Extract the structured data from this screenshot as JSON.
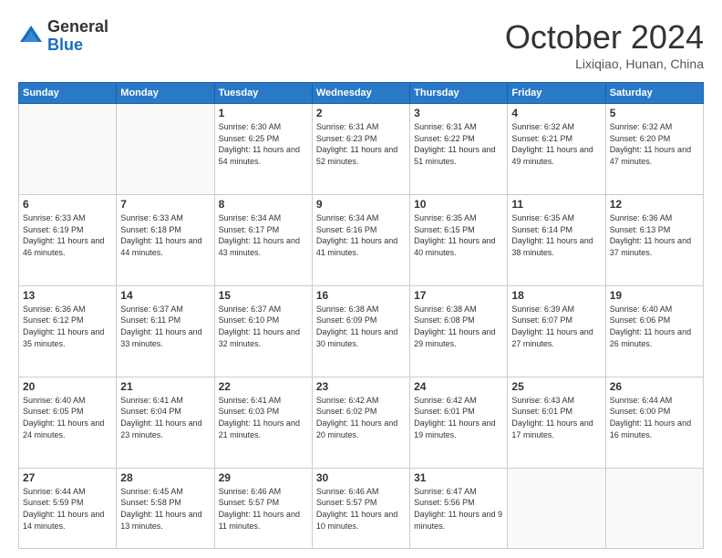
{
  "logo": {
    "general": "General",
    "blue": "Blue"
  },
  "header": {
    "month": "October 2024",
    "location": "Lixiqiao, Hunan, China"
  },
  "weekdays": [
    "Sunday",
    "Monday",
    "Tuesday",
    "Wednesday",
    "Thursday",
    "Friday",
    "Saturday"
  ],
  "weeks": [
    [
      {
        "day": "",
        "info": ""
      },
      {
        "day": "",
        "info": ""
      },
      {
        "day": "1",
        "info": "Sunrise: 6:30 AM\nSunset: 6:25 PM\nDaylight: 11 hours and 54 minutes."
      },
      {
        "day": "2",
        "info": "Sunrise: 6:31 AM\nSunset: 6:23 PM\nDaylight: 11 hours and 52 minutes."
      },
      {
        "day": "3",
        "info": "Sunrise: 6:31 AM\nSunset: 6:22 PM\nDaylight: 11 hours and 51 minutes."
      },
      {
        "day": "4",
        "info": "Sunrise: 6:32 AM\nSunset: 6:21 PM\nDaylight: 11 hours and 49 minutes."
      },
      {
        "day": "5",
        "info": "Sunrise: 6:32 AM\nSunset: 6:20 PM\nDaylight: 11 hours and 47 minutes."
      }
    ],
    [
      {
        "day": "6",
        "info": "Sunrise: 6:33 AM\nSunset: 6:19 PM\nDaylight: 11 hours and 46 minutes."
      },
      {
        "day": "7",
        "info": "Sunrise: 6:33 AM\nSunset: 6:18 PM\nDaylight: 11 hours and 44 minutes."
      },
      {
        "day": "8",
        "info": "Sunrise: 6:34 AM\nSunset: 6:17 PM\nDaylight: 11 hours and 43 minutes."
      },
      {
        "day": "9",
        "info": "Sunrise: 6:34 AM\nSunset: 6:16 PM\nDaylight: 11 hours and 41 minutes."
      },
      {
        "day": "10",
        "info": "Sunrise: 6:35 AM\nSunset: 6:15 PM\nDaylight: 11 hours and 40 minutes."
      },
      {
        "day": "11",
        "info": "Sunrise: 6:35 AM\nSunset: 6:14 PM\nDaylight: 11 hours and 38 minutes."
      },
      {
        "day": "12",
        "info": "Sunrise: 6:36 AM\nSunset: 6:13 PM\nDaylight: 11 hours and 37 minutes."
      }
    ],
    [
      {
        "day": "13",
        "info": "Sunrise: 6:36 AM\nSunset: 6:12 PM\nDaylight: 11 hours and 35 minutes."
      },
      {
        "day": "14",
        "info": "Sunrise: 6:37 AM\nSunset: 6:11 PM\nDaylight: 11 hours and 33 minutes."
      },
      {
        "day": "15",
        "info": "Sunrise: 6:37 AM\nSunset: 6:10 PM\nDaylight: 11 hours and 32 minutes."
      },
      {
        "day": "16",
        "info": "Sunrise: 6:38 AM\nSunset: 6:09 PM\nDaylight: 11 hours and 30 minutes."
      },
      {
        "day": "17",
        "info": "Sunrise: 6:38 AM\nSunset: 6:08 PM\nDaylight: 11 hours and 29 minutes."
      },
      {
        "day": "18",
        "info": "Sunrise: 6:39 AM\nSunset: 6:07 PM\nDaylight: 11 hours and 27 minutes."
      },
      {
        "day": "19",
        "info": "Sunrise: 6:40 AM\nSunset: 6:06 PM\nDaylight: 11 hours and 26 minutes."
      }
    ],
    [
      {
        "day": "20",
        "info": "Sunrise: 6:40 AM\nSunset: 6:05 PM\nDaylight: 11 hours and 24 minutes."
      },
      {
        "day": "21",
        "info": "Sunrise: 6:41 AM\nSunset: 6:04 PM\nDaylight: 11 hours and 23 minutes."
      },
      {
        "day": "22",
        "info": "Sunrise: 6:41 AM\nSunset: 6:03 PM\nDaylight: 11 hours and 21 minutes."
      },
      {
        "day": "23",
        "info": "Sunrise: 6:42 AM\nSunset: 6:02 PM\nDaylight: 11 hours and 20 minutes."
      },
      {
        "day": "24",
        "info": "Sunrise: 6:42 AM\nSunset: 6:01 PM\nDaylight: 11 hours and 19 minutes."
      },
      {
        "day": "25",
        "info": "Sunrise: 6:43 AM\nSunset: 6:01 PM\nDaylight: 11 hours and 17 minutes."
      },
      {
        "day": "26",
        "info": "Sunrise: 6:44 AM\nSunset: 6:00 PM\nDaylight: 11 hours and 16 minutes."
      }
    ],
    [
      {
        "day": "27",
        "info": "Sunrise: 6:44 AM\nSunset: 5:59 PM\nDaylight: 11 hours and 14 minutes."
      },
      {
        "day": "28",
        "info": "Sunrise: 6:45 AM\nSunset: 5:58 PM\nDaylight: 11 hours and 13 minutes."
      },
      {
        "day": "29",
        "info": "Sunrise: 6:46 AM\nSunset: 5:57 PM\nDaylight: 11 hours and 11 minutes."
      },
      {
        "day": "30",
        "info": "Sunrise: 6:46 AM\nSunset: 5:57 PM\nDaylight: 11 hours and 10 minutes."
      },
      {
        "day": "31",
        "info": "Sunrise: 6:47 AM\nSunset: 5:56 PM\nDaylight: 11 hours and 9 minutes."
      },
      {
        "day": "",
        "info": ""
      },
      {
        "day": "",
        "info": ""
      }
    ]
  ]
}
